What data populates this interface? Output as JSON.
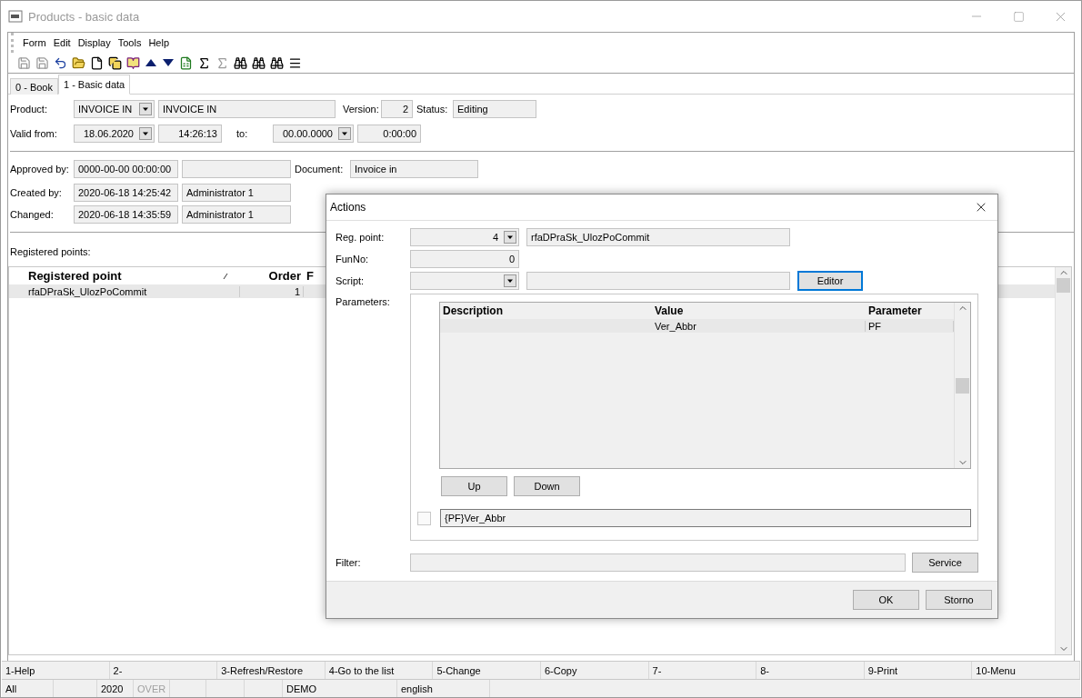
{
  "window": {
    "title": "Products - basic data"
  },
  "menu": [
    "Form",
    "Edit",
    "Display",
    "Tools",
    "Help"
  ],
  "toolbar": [
    {
      "disabled": true
    },
    {
      "disabled": true
    },
    {
      "disabled": false
    },
    {
      "disabled": false
    },
    {
      "disabled": false
    },
    {
      "disabled": false
    },
    {
      "disabled": false
    },
    {
      "disabled": false
    },
    {
      "disabled": false
    },
    {
      "disabled": false
    },
    {
      "disabled": false
    },
    {
      "disabled": true
    },
    {
      "disabled": false
    },
    {
      "disabled": false
    },
    {
      "disabled": false
    },
    {
      "disabled": false
    }
  ],
  "tabs": [
    {
      "label": "0 - Book",
      "selected": false
    },
    {
      "label": "1 - Basic data",
      "selected": true
    }
  ],
  "product": {
    "label": "Product:",
    "code": "INVOICE IN",
    "name": "INVOICE IN"
  },
  "version": {
    "label": "Version:",
    "value": "2"
  },
  "status": {
    "label": "Status:",
    "value": "Editing"
  },
  "valid_from": {
    "label": "Valid from:",
    "date": "18.06.2020",
    "time": "14:26:13"
  },
  "valid_to": {
    "label": "to:",
    "date": "00.00.0000",
    "time": "0:00:00"
  },
  "approved_by": {
    "label": "Approved by:",
    "date": "0000-00-00 00:00:00"
  },
  "document": {
    "label": "Document:",
    "value": "Invoice in"
  },
  "created_by": {
    "label": "Created by:",
    "date": "2020-06-18 14:25:42",
    "user": "Administrator 1"
  },
  "changed": {
    "label": "Changed:",
    "date": "2020-06-18 14:35:59",
    "user": "Administrator 1"
  },
  "registered_points": {
    "label": "Registered points:",
    "columns": [
      "Registered point",
      "Order",
      "F"
    ],
    "rows": [
      {
        "registered_point": "rfaDPraSk_UlozPoCommit",
        "order": "1",
        "selected": true
      }
    ]
  },
  "dialog": {
    "title": "Actions",
    "reg_point": {
      "label": "Reg. point:",
      "number": "4",
      "name": "rfaDPraSk_UlozPoCommit"
    },
    "fun_no": {
      "label": "FunNo:",
      "value": "0"
    },
    "script": {
      "label": "Script:",
      "button": "Editor"
    },
    "parameters": {
      "label": "Parameters:",
      "columns": [
        "Description",
        "Value",
        "Parameter"
      ],
      "rows": [
        {
          "value": "Ver_Abbr",
          "parameter": "PF",
          "selected": true
        }
      ],
      "buttons": [
        "Up",
        "Down"
      ],
      "checked": false,
      "expression": "{PF}Ver_Abbr"
    },
    "filter": {
      "label": "Filter:",
      "button": "Service"
    },
    "buttons": [
      "OK",
      "Storno"
    ]
  },
  "function_keys": [
    "1-Help",
    "2-",
    "3-Refresh/Restore",
    "4-Go to the list",
    "5-Change",
    "6-Copy",
    "7-",
    "8-",
    "9-Print",
    "10-Menu"
  ],
  "status_bar": [
    {
      "text": "All",
      "disabled": false
    },
    {
      "text": "2020",
      "disabled": false
    },
    {
      "text": "OVER",
      "disabled": true
    },
    {
      "text": "DEMO",
      "disabled": false
    },
    {
      "text": "english",
      "disabled": false
    }
  ]
}
